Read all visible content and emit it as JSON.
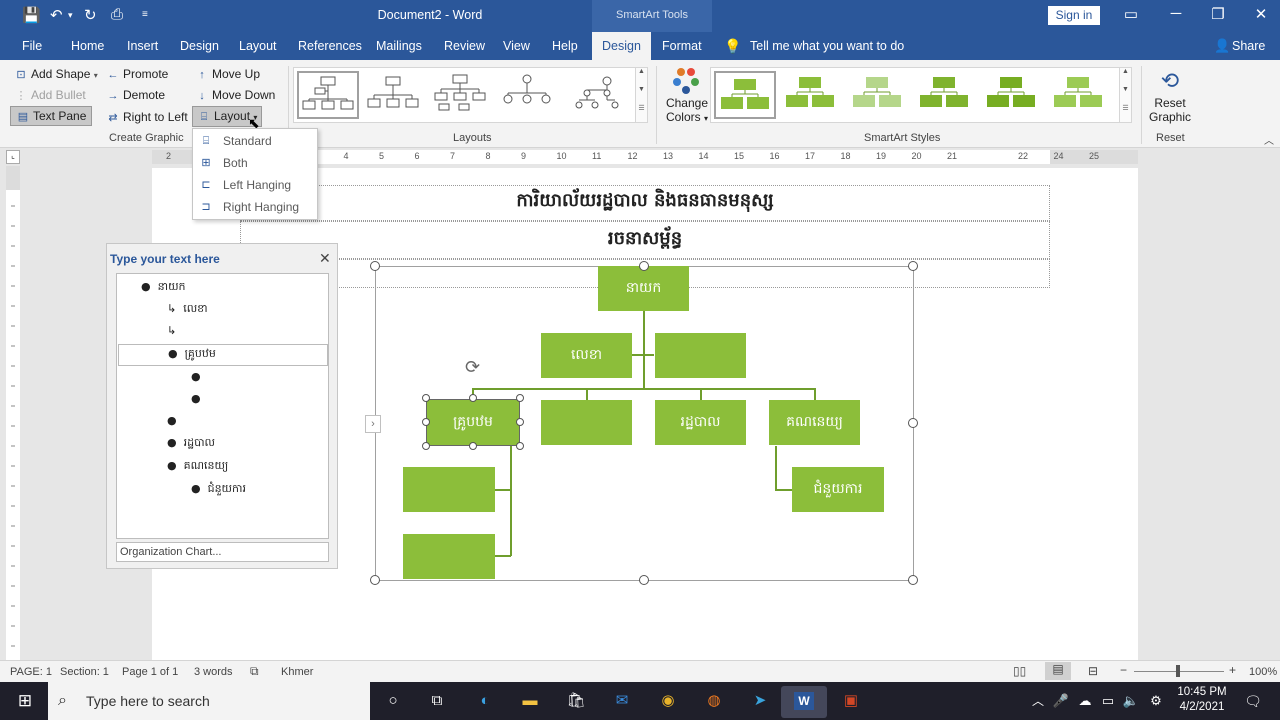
{
  "window": {
    "title": "Document2  -  Word",
    "context_group": "SmartArt Tools",
    "sign_in": "Sign in"
  },
  "tabs": [
    "File",
    "Home",
    "Insert",
    "Design",
    "Layout",
    "References",
    "Mailings",
    "Review",
    "View",
    "Help",
    "Design",
    "Format"
  ],
  "tell_me": "Tell me what you want to do",
  "share": "Share",
  "ribbon": {
    "create_graphic": {
      "add_shape": "Add Shape",
      "add_bullet": "Add Bullet",
      "text_pane": "Text Pane",
      "promote": "Promote",
      "demote": "Demote",
      "right_to_left": "Right to Left",
      "move_up": "Move Up",
      "move_down": "Move Down",
      "layout": "Layout",
      "label": "Create Graphic"
    },
    "layouts_label": "Layouts",
    "change_colors_1": "Change",
    "change_colors_2": "Colors",
    "styles_label": "SmartArt Styles",
    "reset_graphic_1": "Reset",
    "reset_graphic_2": "Graphic",
    "reset_label": "Reset"
  },
  "layout_menu": [
    "Standard",
    "Both",
    "Left Hanging",
    "Right Hanging"
  ],
  "ruler_numbers": [
    "2",
    "1",
    "1",
    "2",
    "3",
    "4",
    "5",
    "6",
    "7",
    "8",
    "9",
    "10",
    "11",
    "12",
    "13",
    "14",
    "15",
    "16",
    "17",
    "18",
    "19",
    "20",
    "21",
    "22",
    "24",
    "25"
  ],
  "document": {
    "heading1": "ការិយាល័យរដ្ឋបាល និងធនធានមនុស្ស",
    "heading2": "រចនាសម្ព័ន្ធ"
  },
  "smartart": {
    "top": "នាយក",
    "assistant": "លេខា",
    "level2": [
      "គ្រូបឋម",
      "",
      "រដ្ឋបាល",
      "គណនេយ្យ"
    ],
    "sub_accounting": "ជំនួយការ"
  },
  "text_pane": {
    "title": "Type your text here",
    "items": [
      "នាយក",
      "លេខា",
      "",
      "គ្រូបឋម",
      "",
      "",
      "",
      "រដ្ឋបាល",
      "គណនេយ្យ",
      "ជំនួយការ"
    ],
    "footer": "Organization Chart..."
  },
  "status": {
    "page": "PAGE: 1",
    "section": "Section: 1",
    "page_of": "Page 1 of 1",
    "words": "3 words",
    "language": "Khmer",
    "zoom": "100%"
  },
  "taskbar": {
    "search_placeholder": "Type here to search",
    "time": "10:45 PM",
    "date": "4/2/2021"
  },
  "colors": {
    "word_blue": "#2b579a",
    "node_green": "#8cbe3a",
    "connector_green": "#6f9e2d"
  }
}
